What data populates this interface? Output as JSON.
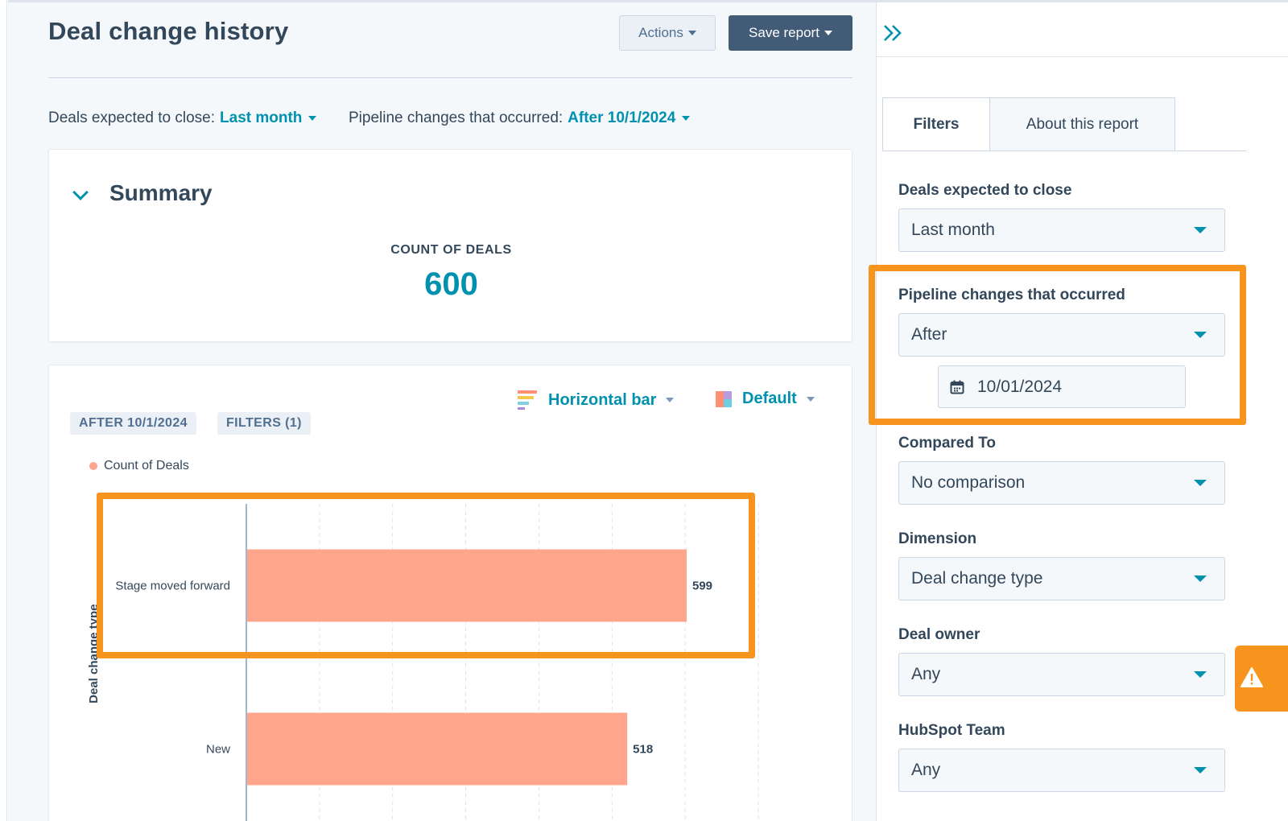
{
  "page": {
    "title": "Deal change history",
    "actions_label": "Actions",
    "save_label": "Save report"
  },
  "filters_bar": {
    "deals_close_label": "Deals expected to close:",
    "deals_close_value": "Last month",
    "pipeline_label": "Pipeline changes that occurred:",
    "pipeline_value": "After 10/1/2024"
  },
  "summary": {
    "title": "Summary",
    "count_label": "COUNT OF DEALS",
    "count_value": "600"
  },
  "chart_card": {
    "viz_type": "Horizontal bar",
    "color_scheme": "Default",
    "tags": [
      "AFTER 10/1/2024",
      "FILTERS (1)"
    ],
    "legend": "Count of Deals"
  },
  "chart_data": {
    "type": "bar",
    "orientation": "horizontal",
    "categories": [
      "Stage moved forward",
      "New"
    ],
    "values": [
      599,
      518
    ],
    "series": [
      {
        "name": "Count of Deals",
        "values": [
          599,
          518
        ]
      }
    ],
    "ylabel": "Deal change type",
    "bar_color": "#ffa58c",
    "grid": true,
    "data_labels": true
  },
  "panel": {
    "tabs": [
      "Filters",
      "About this report"
    ],
    "fields": [
      {
        "label": "Deals expected to close",
        "value": "Last month"
      },
      {
        "label": "Pipeline changes that occurred",
        "value": "After",
        "date": "10/01/2024"
      },
      {
        "label": "Compared To",
        "value": "No comparison"
      },
      {
        "label": "Dimension",
        "value": "Deal change type"
      },
      {
        "label": "Deal owner",
        "value": "Any"
      },
      {
        "label": "HubSpot Team",
        "value": "Any"
      }
    ]
  },
  "colors": {
    "accent": "#0091ae",
    "text": "#33475b",
    "highlight": "#f7941d",
    "bar": "#ffa58c",
    "primary_button": "#425b76"
  },
  "icons": [
    "chevron-down-icon",
    "double-chevron-right-icon",
    "calendar-icon",
    "warning-icon",
    "horizontal-bar-chart-icon",
    "color-swatch-icon"
  ]
}
